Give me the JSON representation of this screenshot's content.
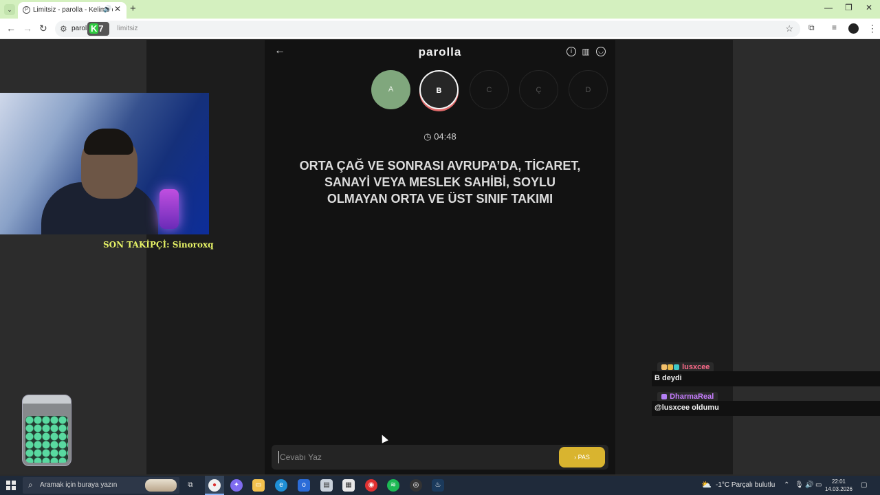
{
  "browser": {
    "tab_title": "Limitsiz - parolla - Kelime oyunu",
    "tab_favicon": "P",
    "address_prefix": "paroll",
    "address_dim": "limitsiz",
    "k7_logo": "7",
    "k7_k": "K"
  },
  "game": {
    "title": "parolla",
    "letters": [
      {
        "label": "A",
        "state": "done"
      },
      {
        "label": "B",
        "state": "current"
      },
      {
        "label": "C",
        "state": "pending"
      },
      {
        "label": "Ç",
        "state": "pending"
      },
      {
        "label": "D",
        "state": "pending"
      }
    ],
    "timer": "04:48",
    "question": "ORTA ÇAĞ VE SONRASI AVRUPA’DA, TİCARET, SANAYİ VEYA MESLEK SAHİBİ, SOYLU OLMAYAN ORTA VE ÜST SINIF TAKIMI",
    "answer_placeholder": "Cevabı Yaz",
    "pass_label": "PAS",
    "colors": {
      "done": "#80a77d",
      "pass": "#d9b42f",
      "current_ring": "#e06a6a"
    }
  },
  "stream": {
    "follower_text": "SON TAKİPÇİ: Sinoroxq"
  },
  "chat": [
    {
      "user": "lusxcee",
      "user_color": "#ff6b8a",
      "message": "B deydi"
    },
    {
      "user": "DharmaReal",
      "user_color": "#c77dff",
      "message": "@lusxcee oldumu"
    }
  ],
  "taskbar": {
    "search_placeholder": "Aramak için buraya yazın",
    "weather": "-1°C  Parçalı bulutlu",
    "time": "22:01",
    "date": "14.03.2026"
  }
}
